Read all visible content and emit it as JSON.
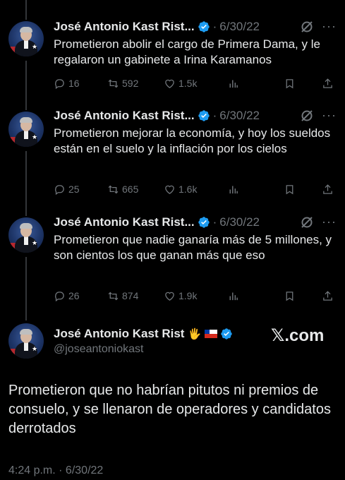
{
  "replies": [
    {
      "name": "José Antonio Kast Rist...",
      "date": "6/30/22",
      "text": "Prometieron abolir el cargo de Primera Dama, y le regalaron un gabinete a Irina Karamanos",
      "replies": "16",
      "reposts": "592",
      "likes": "1.5k"
    },
    {
      "name": "José Antonio Kast Rist...",
      "date": "6/30/22",
      "text": "Prometieron mejorar la economía, y hoy los sueldos están en el suelo y la inflación por los cielos",
      "replies": "25",
      "reposts": "665",
      "likes": "1.6k"
    },
    {
      "name": "José Antonio Kast Rist...",
      "date": "6/30/22",
      "text": "Prometieron que nadie ganaría más de 5 millones, y son cientos los que ganan más que eso",
      "replies": "26",
      "reposts": "874",
      "likes": "1.9k"
    }
  ],
  "separator": "·",
  "main_tweet": {
    "name": "José Antonio Kast Rist",
    "hand_emoji": "🖐",
    "handle": "@joseantoniokast",
    "watermark": "𝕏.com",
    "text": "Prometieron que no habrían pitutos ni premios de consuelo, y se llenaron de operadores y candidatos derrotados",
    "timestamp": "4:24 p.m. · 6/30/22"
  },
  "colors": {
    "background": "#000000",
    "text": "#e7e9ea",
    "muted": "#71767b",
    "verified": "#1d9bf0",
    "thread_line": "#333639"
  }
}
